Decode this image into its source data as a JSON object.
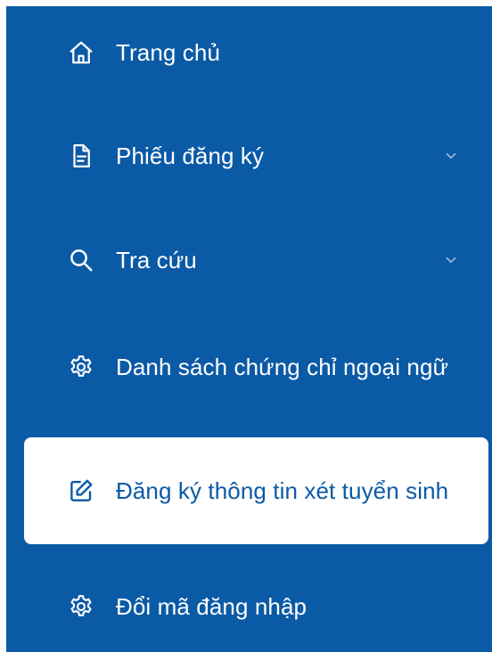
{
  "sidebar": {
    "items": [
      {
        "label": "Trang chủ",
        "icon": "home-icon",
        "expandable": false,
        "active": false
      },
      {
        "label": "Phiếu đăng ký",
        "icon": "document-icon",
        "expandable": true,
        "active": false
      },
      {
        "label": "Tra cứu",
        "icon": "search-icon",
        "expandable": true,
        "active": false
      },
      {
        "label": "Danh sách chứng chỉ ngoại ngữ",
        "icon": "gear-icon",
        "expandable": false,
        "active": false
      },
      {
        "label": "Đăng ký thông tin xét tuyển sinh",
        "icon": "edit-icon",
        "expandable": false,
        "active": true
      },
      {
        "label": "Đổi mã đăng nhập",
        "icon": "gear-icon",
        "expandable": false,
        "active": false
      }
    ],
    "colors": {
      "background": "#0b5aa6",
      "active_background": "#ffffff",
      "text": "#ffffff",
      "active_text": "#0b5aa6"
    }
  }
}
